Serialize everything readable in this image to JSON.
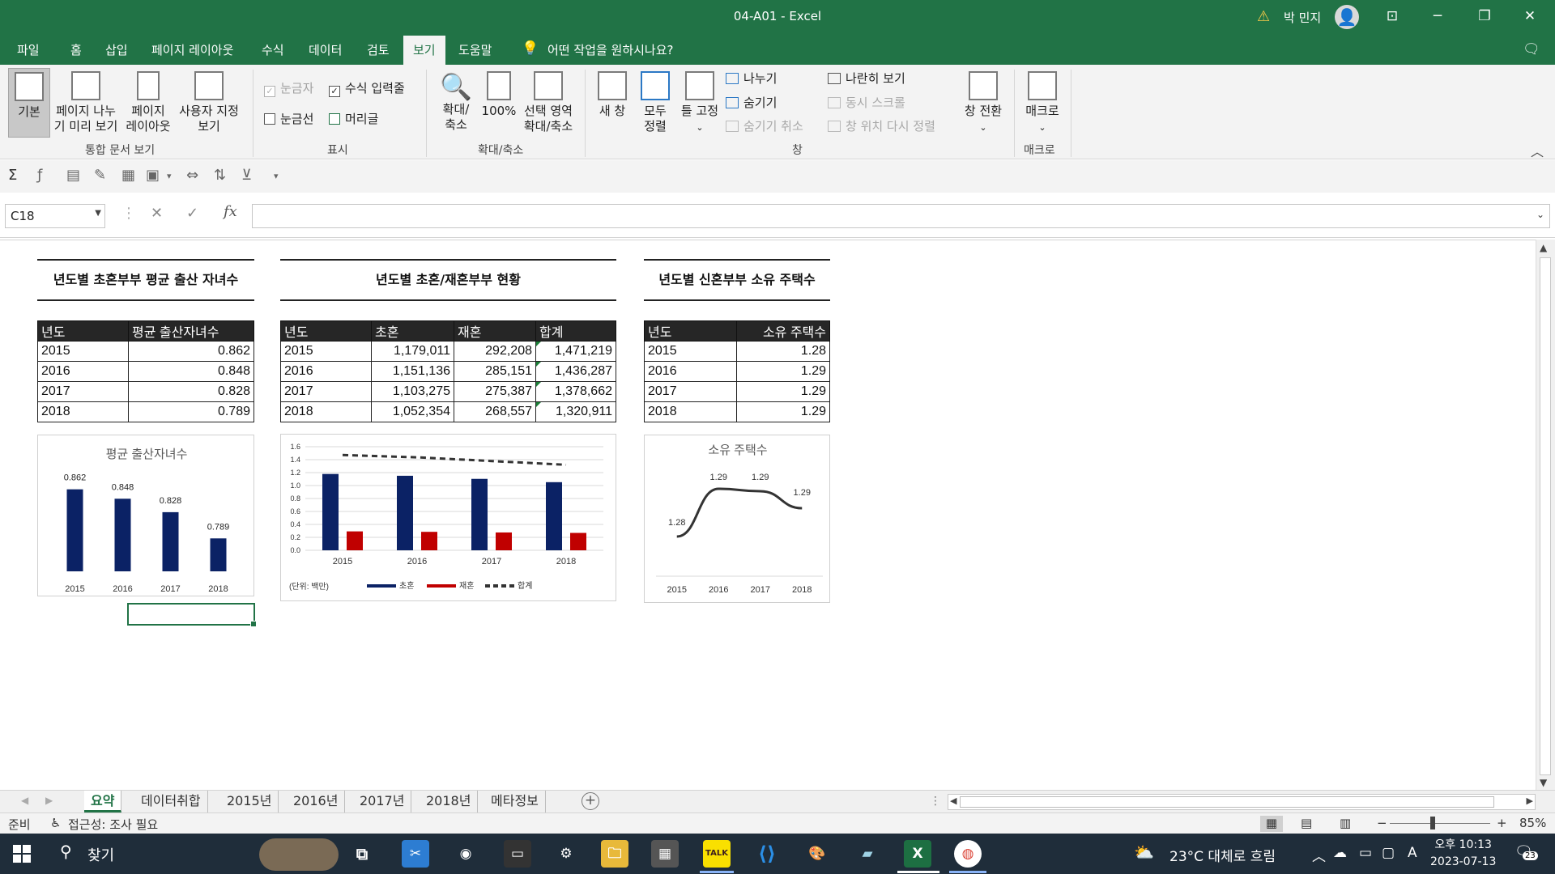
{
  "window": {
    "title": "04-A01  -  Excel",
    "user": "박 민지",
    "minimize": "─",
    "restore": "❐",
    "close": "✕",
    "ribbon_display": "⊡"
  },
  "tabs": [
    "파일",
    "홈",
    "삽입",
    "페이지 레이아웃",
    "수식",
    "데이터",
    "검토",
    "보기",
    "도움말"
  ],
  "active_tab": "보기",
  "tell_me": "어떤 작업을 원하시나요?",
  "ribbon": {
    "workbook_views": {
      "label": "통합 문서 보기",
      "normal": "기본",
      "page_break_1": "페이지 나누",
      "page_break_2": "기 미리 보기",
      "page_layout_1": "페이지",
      "page_layout_2": "레이아웃",
      "custom_1": "사용자 지정",
      "custom_2": "보기"
    },
    "show": {
      "label": "표시",
      "ruler": "눈금자",
      "formula_bar": "수식 입력줄",
      "gridlines": "눈금선",
      "headings": "머리글"
    },
    "zoom": {
      "label": "확대/축소",
      "zoom_1": "확대/",
      "zoom_2": "축소",
      "hundred": "100%",
      "to_selection_1": "선택 영역",
      "to_selection_2": "확대/축소"
    },
    "window": {
      "label": "창",
      "new_window": "새 창",
      "arrange_1": "모두",
      "arrange_2": "정렬",
      "freeze": "틀 고정",
      "split": "나누기",
      "hide": "숨기기",
      "unhide": "숨기기 취소",
      "side_by_side": "나란히 보기",
      "sync_scroll": "동시 스크롤",
      "reset_position": "창 위치 다시 정렬",
      "switch": "창 전환"
    },
    "macros": {
      "label": "매크로",
      "macros_btn": "매크로"
    }
  },
  "formula_bar": {
    "name_box": "C18",
    "cancel": "✕",
    "enter": "✓",
    "fx": "fx",
    "value": ""
  },
  "sheet": {
    "section1_title": "년도별 초혼부부 평균 출산 자녀수",
    "section2_title": "년도별 초혼/재혼부부 현황",
    "section3_title": "년도별 신혼부부 소유 주택수",
    "table1": {
      "headers": [
        "년도",
        "평균 출산자녀수"
      ],
      "rows": [
        [
          "2015",
          "0.862"
        ],
        [
          "2016",
          "0.848"
        ],
        [
          "2017",
          "0.828"
        ],
        [
          "2018",
          "0.789"
        ]
      ]
    },
    "table2": {
      "headers": [
        "년도",
        "초혼",
        "재혼",
        "합계"
      ],
      "rows": [
        [
          "2015",
          "1,179,011",
          "292,208",
          "1,471,219"
        ],
        [
          "2016",
          "1,151,136",
          "285,151",
          "1,436,287"
        ],
        [
          "2017",
          "1,103,275",
          "275,387",
          "1,378,662"
        ],
        [
          "2018",
          "1,052,354",
          "268,557",
          "1,320,911"
        ]
      ]
    },
    "table3": {
      "headers": [
        "년도",
        "소유 주택수"
      ],
      "rows": [
        [
          "2015",
          "1.28"
        ],
        [
          "2016",
          "1.29"
        ],
        [
          "2017",
          "1.29"
        ],
        [
          "2018",
          "1.29"
        ]
      ]
    }
  },
  "chart_data": [
    {
      "type": "bar",
      "title": "평균 출산자녀수",
      "categories": [
        "2015",
        "2016",
        "2017",
        "2018"
      ],
      "values": [
        0.862,
        0.848,
        0.828,
        0.789
      ],
      "data_labels": [
        "0.862",
        "0.848",
        "0.828",
        "0.789"
      ],
      "ylim": [
        0.74,
        0.87
      ],
      "color": "#0b2265",
      "grid": false
    },
    {
      "type": "bar",
      "title": "",
      "categories": [
        "2015",
        "2016",
        "2017",
        "2018"
      ],
      "series": [
        {
          "name": "초혼",
          "type": "bar",
          "color": "#0b2265",
          "values": [
            1.179011,
            1.151136,
            1.103275,
            1.052354
          ]
        },
        {
          "name": "재혼",
          "type": "bar",
          "color": "#c00000",
          "values": [
            0.292208,
            0.285151,
            0.275387,
            0.268557
          ]
        },
        {
          "name": "합계",
          "type": "line",
          "dashed": true,
          "color": "#333333",
          "values": [
            1.471219,
            1.436287,
            1.378662,
            1.320911
          ]
        }
      ],
      "ylim": [
        0,
        1.6
      ],
      "yticks": [
        "0.0",
        "0.2",
        "0.4",
        "0.6",
        "0.8",
        "1.0",
        "1.2",
        "1.4",
        "1.6"
      ],
      "unit_note": "(단위: 백만)",
      "grid": true,
      "legend": "bottom"
    },
    {
      "type": "line",
      "title": "소유 주택수",
      "categories": [
        "2015",
        "2016",
        "2017",
        "2018"
      ],
      "values": [
        1.28,
        1.29,
        1.29,
        1.29
      ],
      "data_labels": [
        "1.28",
        "1.29",
        "1.29",
        "1.29"
      ],
      "smooth": true,
      "color": "#333333"
    }
  ],
  "sheet_tabs": [
    "요약",
    "데이터취합",
    "2015년",
    "2016년",
    "2017년",
    "2018년",
    "메타정보"
  ],
  "active_sheet": "요약",
  "status": {
    "ready": "준비",
    "accessibility": "접근성: 조사 필요",
    "zoom": "85%"
  },
  "taskbar": {
    "search": "찾기",
    "weather": "23°C  대체로 흐림",
    "time": "오후 10:13",
    "date": "2023-07-13",
    "notifications": "23",
    "kakao": "TALK",
    "excel": "X"
  },
  "colors": {
    "excel_green": "#217346",
    "navy": "#0b2265",
    "red": "#c00000"
  }
}
